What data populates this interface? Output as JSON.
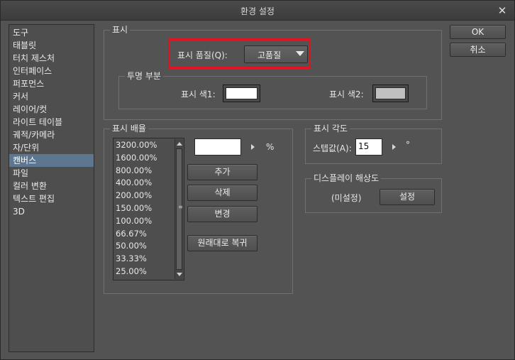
{
  "window": {
    "title": "환경 설정",
    "close_symbol": "✕"
  },
  "sidebar": {
    "items": [
      {
        "label": "도구"
      },
      {
        "label": "태블릿"
      },
      {
        "label": "터치 제스처"
      },
      {
        "label": "인터페이스"
      },
      {
        "label": "퍼포먼스"
      },
      {
        "label": "커서"
      },
      {
        "label": "레이어/컷"
      },
      {
        "label": "라이트 테이블"
      },
      {
        "label": "궤적/카메라"
      },
      {
        "label": "자/단위"
      },
      {
        "label": "캔버스"
      },
      {
        "label": "파일"
      },
      {
        "label": "컬러 변환"
      },
      {
        "label": "텍스트 편집"
      },
      {
        "label": "3D"
      }
    ],
    "selected": "캔버스"
  },
  "display": {
    "group_title": "표시",
    "quality_label": "표시 품질(Q):",
    "quality_value": "고품질",
    "transparency": {
      "group_title": "투명 부분",
      "color1_label": "표시 색1:",
      "color1_value": "#ffffff",
      "color2_label": "표시 색2:",
      "color2_value": "#c0c0c0"
    }
  },
  "zoom": {
    "group_title": "표시 배율",
    "levels": [
      "3200.00%",
      "1600.00%",
      "800.00%",
      "400.00%",
      "200.00%",
      "150.00%",
      "100.00%",
      "66.67%",
      "50.00%",
      "33.33%",
      "25.00%"
    ],
    "input_value": "",
    "unit": "%",
    "add_label": "추가",
    "delete_label": "삭제",
    "change_label": "변경",
    "restore_label": "원래대로 복귀"
  },
  "angle": {
    "group_title": "표시 각도",
    "step_label": "스텝값(A):",
    "step_value": "15",
    "unit": "°"
  },
  "resolution": {
    "group_title": "디스플레이 해상도",
    "status": "(미설정)",
    "settings_label": "설정"
  },
  "actions": {
    "ok_label": "OK",
    "cancel_label": "취소"
  },
  "colors": {
    "highlight": "#e0141e",
    "selection": "#5d7790"
  }
}
